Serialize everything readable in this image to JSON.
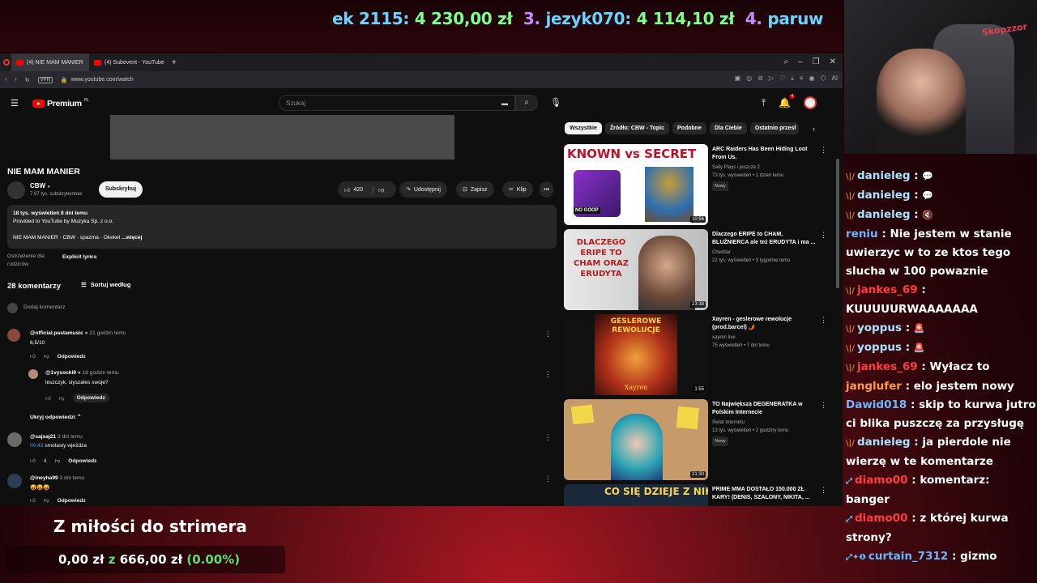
{
  "ticker": {
    "part1": "ek 2115:",
    "amt1": "4 230,00 zł",
    "num3": "3.",
    "user3": "jezyk070:",
    "amt3": "4 114,10 zł",
    "num4": "4.",
    "user4": "paruw"
  },
  "browser": {
    "tabs": [
      {
        "label": "(4) NIE MAM MANIER"
      },
      {
        "label": "(4) Subevent - YouTube"
      }
    ],
    "url": "www.youtube.com/watch",
    "vpn": "VPN"
  },
  "yt": {
    "brand": "Premium",
    "region": "PL",
    "search_placeholder": "Szukaj",
    "notif_count": "4",
    "video_title": "NIE MAM MANIER",
    "channel": "CBW",
    "subs": "7,97 tys. subskrybentów",
    "subscribe": "Subskrybuj",
    "likes": "420",
    "share": "Udostępnij",
    "save": "Zapisz",
    "clip": "Klip",
    "desc_line1": "18 tys. wyświetleń  8 dni temu",
    "desc_line2": "Provided to YouTube by Muzyka Sp. z o.o.",
    "desc_line3": "NIE MAM MANIER · CBW · spazma · Okekel",
    "desc_more": "...więcej",
    "warn_label": "Ostrzeżenie dla rodziców",
    "warn_value": "Explicit lyrics",
    "comments_count": "28 komentarzy",
    "sort_label": "Sortuj według",
    "add_comment": "Dodaj komentarz",
    "reply_label": "Odpowiedz",
    "hide_replies": "Ukryj odpowiedzi",
    "comments": [
      {
        "author": "@official.pastamusic",
        "time": "21 godzin temu",
        "text": "6,5/10",
        "likes": ""
      },
      {
        "author": "@1vysocki9",
        "time": "18 godzin temu",
        "text": "leszczyk, slyszales swoje?",
        "likes": ""
      },
      {
        "author": "@sajsaj21",
        "time": "3 dni temu",
        "ts": "00:43",
        "text": "smolasty wjeżdża",
        "likes": "4"
      },
      {
        "author": "@ineyha99",
        "time": "3 dni temu",
        "text": "😝😝😝",
        "likes": ""
      }
    ],
    "chips": [
      "Wszystkie",
      "Źródło: CBW - Topic",
      "Podobne",
      "Dla Ciebie",
      "Ostatnio przesł"
    ],
    "recs": [
      {
        "thumb": "KNOWN vs SECRET",
        "badge": "NO GOOP",
        "duration": "10:56",
        "title": "ARC Raiders Has Been Hiding Loot From Us.",
        "channel": "Sally Plays i jeszcze 2",
        "meta": "73 tys. wyświetleń • 1 dzień temu",
        "new": "Nowy"
      },
      {
        "thumb": "DLACZEGO ERIPE TO CHAM ORAZ ERUDYTA",
        "duration": "23:38",
        "title": "Dlaczego ERIPE to CHAM, BLUŹNIERCA ale też ERUDYTA i ma ...",
        "channel": "Cheddar",
        "meta": "22 tys. wyświetleń • 3 tygodnie temu",
        "new": ""
      },
      {
        "thumb": "GESLEROWE REWOLUCJE",
        "caption": "Xayren",
        "duration": "1:55",
        "title": "Xayren - geslerowe rewolucje (prod.barcel) 🌶️",
        "channel": "xayren live",
        "meta": "75 wyświetleń • 7 dni temu",
        "new": ""
      },
      {
        "thumb": "",
        "duration": "21:30",
        "title": "TO Największa DEGENERATKA w Polskim Internecie",
        "channel": "Świat Internetu",
        "meta": "13 tys. wyświetleń • 2 godziny temu",
        "new": "Nowy"
      },
      {
        "thumb": "CO SIĘ DZIEJE Z NIKITĄ?",
        "duration": "",
        "title": "PRIME MMA DOSTAŁO 150.000 ZŁ KARY! (DENIS, SZALONY, NIKITA, ...",
        "channel": "",
        "meta": "",
        "new": ""
      }
    ]
  },
  "cam": {
    "sign": "Skopzzor"
  },
  "chat": [
    {
      "user": "danieleg",
      "text": "",
      "emote": "💬",
      "color": "u-g",
      "badge": "\\|/"
    },
    {
      "user": "danieleg",
      "text": "",
      "emote": "💬",
      "color": "u-g",
      "badge": "\\|/"
    },
    {
      "user": "danieleg",
      "text": "",
      "emote": "🔇",
      "color": "u-g",
      "badge": "\\|/"
    },
    {
      "user": "reniu",
      "text": "Nie jestem w stanie uwierzyc w to ze ktos tego slucha w 100 powaznie",
      "color": "u-b",
      "badge": ""
    },
    {
      "user": "jankes_69",
      "text": "KUUUUURWAAAAAAA",
      "color": "u-r",
      "badge": "\\|/"
    },
    {
      "user": "yoppus",
      "text": "",
      "emote": "🚨",
      "color": "u-g",
      "badge": "\\|/"
    },
    {
      "user": "yoppus",
      "text": "",
      "emote": "🚨",
      "color": "u-g",
      "badge": "\\|/"
    },
    {
      "user": "jankes_69",
      "text": "Wyłacz to",
      "color": "u-r",
      "badge": "\\|/"
    },
    {
      "user": "janglufer",
      "text": "elo jestem nowy",
      "color": "u-o",
      "badge": ""
    },
    {
      "user": "Dawid018",
      "text": "skip to kurwa jutro ci blika puszczę za przysługę",
      "color": "u-b",
      "badge": ""
    },
    {
      "user": "danieleg",
      "text": "ja pierdole nie wierzę w te komentarze",
      "color": "u-g",
      "badge": "\\|/"
    },
    {
      "user": "diamo00",
      "text": "komentarz: banger",
      "color": "u-r",
      "badge": "⤢"
    },
    {
      "user": "diamo00",
      "text": "z której kurwa strony?",
      "color": "u-r",
      "badge": "⤢"
    },
    {
      "user": "curtain_7312",
      "text": "gizmo",
      "color": "u-b",
      "badge": "⤢✦❶"
    }
  ],
  "donation": {
    "title": "Z miłości do strimera",
    "current": "0,00 zł",
    "sep": "z",
    "goal": "666,00 zł",
    "pct": "(0.00%)"
  }
}
